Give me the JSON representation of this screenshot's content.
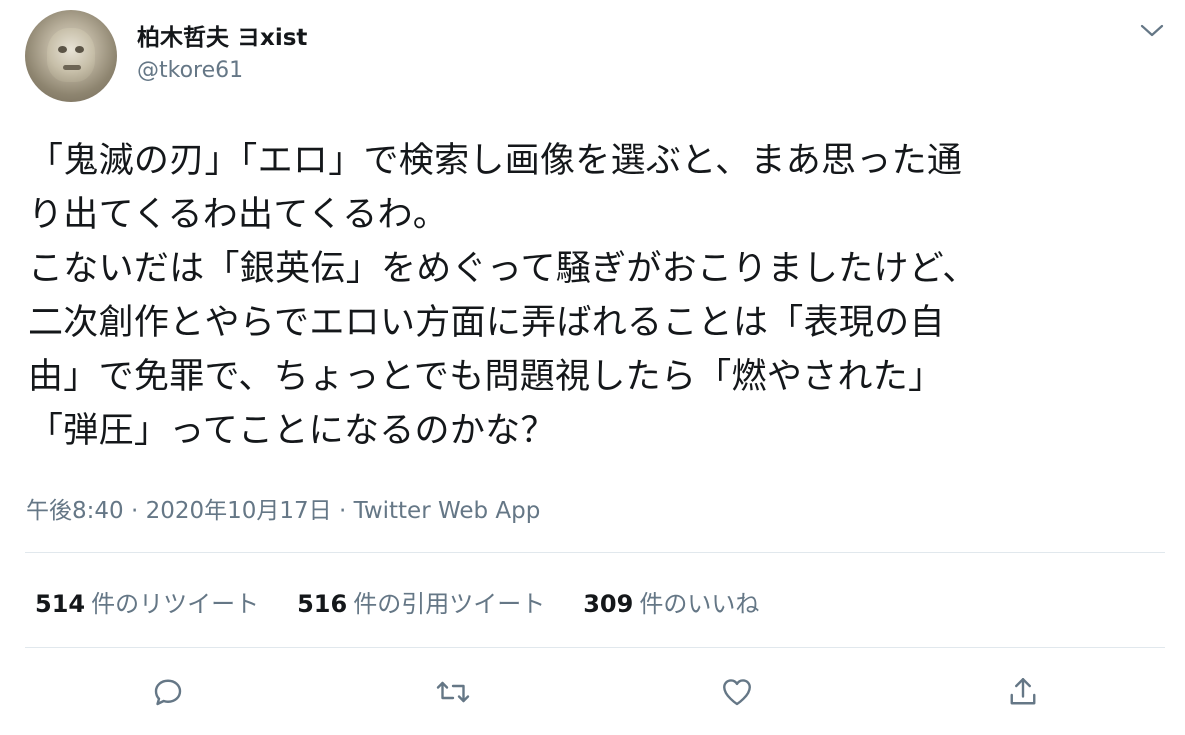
{
  "author": {
    "display_name": "柏木哲夫 ヨxist",
    "handle": "@tkore61"
  },
  "tweet": {
    "text": "「鬼滅の刃」「エロ」で検索し画像を選ぶと、まあ思った通\nり出てくるわ出てくるわ。\nこないだは「銀英伝」をめぐって騒ぎがおこりましたけど、\n二次創作とやらでエロい方面に弄ばれることは「表現の自\n由」で免罪で、ちょっとでも問題視したら「燃やされた」\n「弾圧」ってことになるのかな？",
    "meta": "午後8:40 · 2020年10月17日 · Twitter Web App"
  },
  "stats": [
    {
      "count": "514",
      "label": "件のリツイート"
    },
    {
      "count": "516",
      "label": "件の引用ツイート"
    },
    {
      "count": "309",
      "label": "件のいいね"
    }
  ],
  "icons": {
    "more": "chevron-down-icon",
    "reply": "reply-icon",
    "retweet": "retweet-icon",
    "like": "heart-icon",
    "share": "share-icon"
  },
  "colors": {
    "text": "#14171a",
    "secondary": "#657786",
    "divider": "#e1e8ed"
  }
}
